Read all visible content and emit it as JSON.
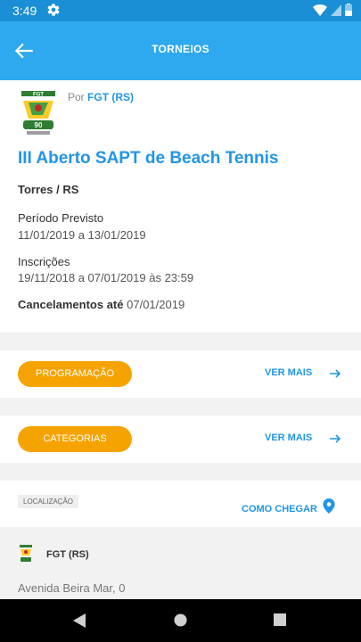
{
  "status": {
    "time": "3:49"
  },
  "appbar": {
    "title": "TORNEIOS"
  },
  "organizer": {
    "by": "Por",
    "name": "FGT (RS)",
    "logo_text": "FGT"
  },
  "tournament": {
    "title": "III Aberto SAPT de Beach Tennis",
    "city": "Torres / RS",
    "period_label": "Período Previsto",
    "period_value": "11/01/2019 a 13/01/2019",
    "inscriptions_label": "Inscrições",
    "inscriptions_value": "19/11/2018 a 07/01/2019 às 23:59",
    "cancel_label": "Cancelamentos até",
    "cancel_value": "07/01/2019"
  },
  "sections": [
    {
      "label": "PROGRAMAÇÃO",
      "more": "VER MAIS"
    },
    {
      "label": "CATEGORIAS",
      "more": "VER MAIS"
    }
  ],
  "location": {
    "badge": "LOCALIZAÇÃO",
    "how_to": "COMO CHEGAR",
    "venue": "FGT (RS)",
    "address": "Avenida Beira Mar, 0"
  },
  "colors": {
    "primary": "#2ea8ee",
    "accent": "#f5a300",
    "link": "#2196e8"
  }
}
